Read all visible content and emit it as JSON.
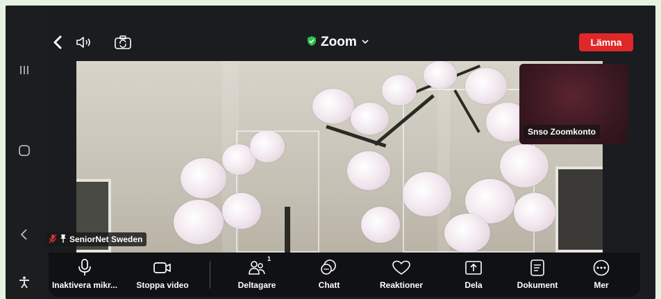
{
  "meeting": {
    "title": "Zoom",
    "leave_label": "Lämna",
    "thumbnail_name": "Snso Zoomkonto",
    "speaker_name": "SeniorNet Sweden"
  },
  "toolbar": {
    "mute_label": "Inaktivera mikr...",
    "video_label": "Stoppa video",
    "participants_label": "Deltagare",
    "participants_count": "1",
    "chat_label": "Chatt",
    "reactions_label": "Reaktioner",
    "share_label": "Dela",
    "documents_label": "Dokument",
    "more_label": "Mer"
  },
  "colors": {
    "leave_button": "#e02828",
    "shield": "#2fbf4f",
    "toolbar_bg": "#101114"
  },
  "icons": [
    "recent-apps-icon",
    "home-icon",
    "back-icon",
    "accessibility-icon",
    "back-arrow-icon",
    "speaker-icon",
    "switch-camera-icon",
    "shield-check-icon",
    "chevron-down-icon",
    "muted-mic-icon",
    "pin-icon",
    "microphone-icon",
    "video-camera-icon",
    "participants-icon",
    "chat-icon",
    "heart-icon",
    "share-upload-icon",
    "document-icon",
    "more-icon"
  ]
}
